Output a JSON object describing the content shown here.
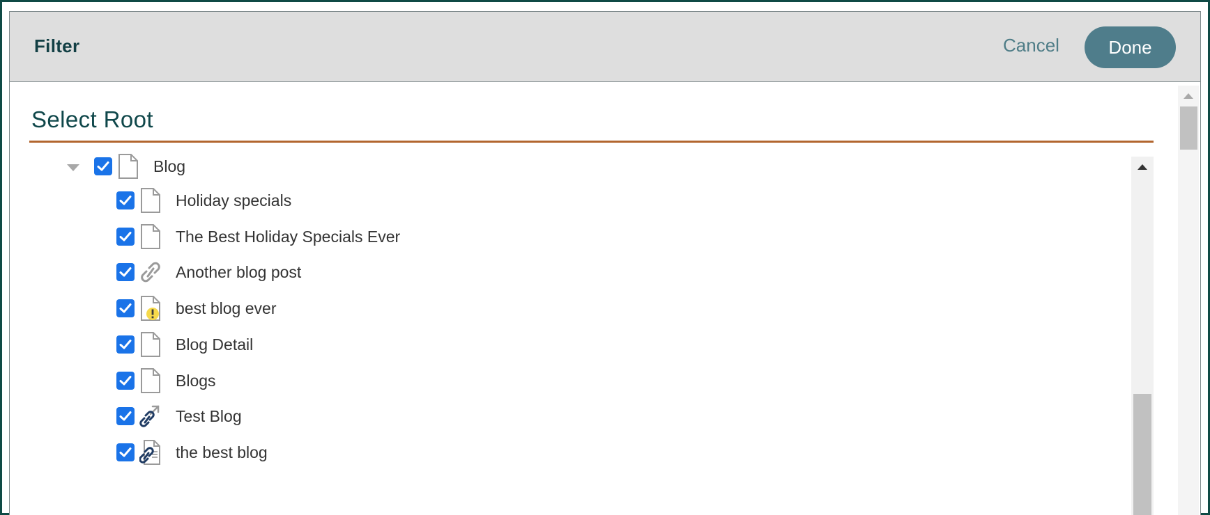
{
  "header": {
    "title": "Filter",
    "cancel_label": "Cancel",
    "done_label": "Done"
  },
  "section": {
    "title": "Select Root"
  },
  "colors": {
    "checkbox": "#1a73e8",
    "done_button": "#4f7d8b",
    "accent_rule": "#b2662e",
    "header_bg": "#dedede"
  },
  "tree": {
    "root": {
      "label": "Blog",
      "checked": true,
      "icon": "page-icon",
      "expanded": true
    },
    "children": [
      {
        "label": "Holiday specials",
        "checked": true,
        "icon": "page-icon"
      },
      {
        "label": "The Best Holiday Specials Ever",
        "checked": true,
        "icon": "page-icon"
      },
      {
        "label": "Another blog post",
        "checked": true,
        "icon": "link-icon"
      },
      {
        "label": "best blog ever",
        "checked": true,
        "icon": "page-warning-icon"
      },
      {
        "label": "Blog Detail",
        "checked": true,
        "icon": "page-icon"
      },
      {
        "label": "Blogs",
        "checked": true,
        "icon": "page-icon"
      },
      {
        "label": "Test Blog",
        "checked": true,
        "icon": "external-link-icon"
      },
      {
        "label": "the best blog",
        "checked": true,
        "icon": "linked-page-icon"
      }
    ]
  }
}
